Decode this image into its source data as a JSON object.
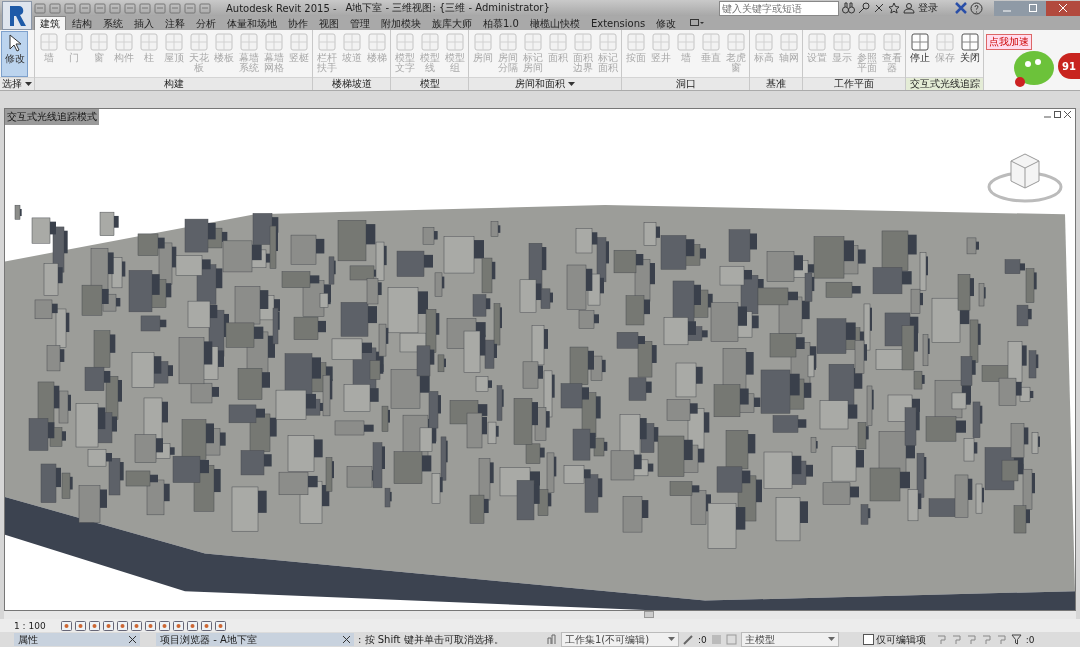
{
  "window": {
    "app_title": "Autodesk Revit 2015 -",
    "document_title": "A地下室 - 三维视图: {三维 - Administrator}"
  },
  "search": {
    "placeholder": "键入关键字或短语"
  },
  "sign_in": "登录",
  "tabs": [
    {
      "label": "建筑",
      "selected": true
    },
    {
      "label": "结构",
      "selected": false
    },
    {
      "label": "系统",
      "selected": false
    },
    {
      "label": "插入",
      "selected": false
    },
    {
      "label": "注释",
      "selected": false
    },
    {
      "label": "分析",
      "selected": false
    },
    {
      "label": "体量和场地",
      "selected": false
    },
    {
      "label": "协作",
      "selected": false
    },
    {
      "label": "视图",
      "selected": false
    },
    {
      "label": "管理",
      "selected": false
    },
    {
      "label": "附加模块",
      "selected": false
    },
    {
      "label": "族库大师",
      "selected": false
    },
    {
      "label": "柏慕1.0",
      "selected": false
    },
    {
      "label": "橄榄山快模",
      "selected": false
    },
    {
      "label": "Extensions",
      "selected": false
    },
    {
      "label": "修改",
      "selected": false
    }
  ],
  "ribbon_panels": [
    {
      "label": "选择",
      "menu": true,
      "highlighted": false,
      "buttons": [
        {
          "label": "修改",
          "selected": true,
          "disabled": false
        }
      ]
    },
    {
      "label": "构建",
      "menu": false,
      "highlighted": false,
      "buttons": [
        {
          "label": "墙",
          "selected": false,
          "disabled": true
        },
        {
          "label": "门",
          "selected": false,
          "disabled": true
        },
        {
          "label": "窗",
          "selected": false,
          "disabled": true
        },
        {
          "label": "构件",
          "selected": false,
          "disabled": true
        },
        {
          "label": "柱",
          "selected": false,
          "disabled": true
        },
        {
          "label": "屋顶",
          "selected": false,
          "disabled": true
        },
        {
          "label": "天花板",
          "selected": false,
          "disabled": true
        },
        {
          "label": "楼板",
          "selected": false,
          "disabled": true
        },
        {
          "label": "幕墙系统",
          "selected": false,
          "disabled": true
        },
        {
          "label": "幕墙网格",
          "selected": false,
          "disabled": true
        },
        {
          "label": "竖梃",
          "selected": false,
          "disabled": true
        }
      ]
    },
    {
      "label": "楼梯坡道",
      "menu": false,
      "highlighted": false,
      "buttons": [
        {
          "label": "栏杆扶手",
          "selected": false,
          "disabled": true
        },
        {
          "label": "坡道",
          "selected": false,
          "disabled": true
        },
        {
          "label": "楼梯",
          "selected": false,
          "disabled": true
        }
      ]
    },
    {
      "label": "模型",
      "menu": false,
      "highlighted": false,
      "buttons": [
        {
          "label": "模型文字",
          "selected": false,
          "disabled": true
        },
        {
          "label": "模型线",
          "selected": false,
          "disabled": true
        },
        {
          "label": "模型组",
          "selected": false,
          "disabled": true
        }
      ]
    },
    {
      "label": "房间和面积",
      "menu": true,
      "highlighted": false,
      "buttons": [
        {
          "label": "房间",
          "selected": false,
          "disabled": true
        },
        {
          "label": "房间分隔",
          "selected": false,
          "disabled": true
        },
        {
          "label": "标记房间",
          "selected": false,
          "disabled": true
        },
        {
          "label": "面积",
          "selected": false,
          "disabled": true
        },
        {
          "label": "面积边界",
          "selected": false,
          "disabled": true
        },
        {
          "label": "标记面积",
          "selected": false,
          "disabled": true
        }
      ]
    },
    {
      "label": "洞口",
      "menu": false,
      "highlighted": false,
      "buttons": [
        {
          "label": "按面",
          "selected": false,
          "disabled": true
        },
        {
          "label": "竖井",
          "selected": false,
          "disabled": true
        },
        {
          "label": "墙",
          "selected": false,
          "disabled": true
        },
        {
          "label": "垂直",
          "selected": false,
          "disabled": true
        },
        {
          "label": "老虎窗",
          "selected": false,
          "disabled": true
        }
      ]
    },
    {
      "label": "基准",
      "menu": false,
      "highlighted": false,
      "buttons": [
        {
          "label": "标高",
          "selected": false,
          "disabled": true
        },
        {
          "label": "轴网",
          "selected": false,
          "disabled": true
        }
      ]
    },
    {
      "label": "工作平面",
      "menu": false,
      "highlighted": false,
      "buttons": [
        {
          "label": "设置",
          "selected": false,
          "disabled": true
        },
        {
          "label": "显示",
          "selected": false,
          "disabled": true
        },
        {
          "label": "参照平面",
          "selected": false,
          "disabled": true
        },
        {
          "label": "查看器",
          "selected": false,
          "disabled": true
        }
      ]
    },
    {
      "label": "交互式光线追踪",
      "menu": false,
      "highlighted": true,
      "buttons": [
        {
          "label": "停止",
          "selected": false,
          "disabled": false
        },
        {
          "label": "保存",
          "selected": false,
          "disabled": true
        },
        {
          "label": "关闭",
          "selected": false,
          "disabled": false
        }
      ]
    }
  ],
  "overlay": {
    "badge": "点我加速",
    "ball": "91"
  },
  "view": {
    "label": "交互式光线追踪模式",
    "scale": "1 : 100"
  },
  "status_bar": {
    "properties_tab": "属性",
    "browser_tab": "项目浏览器 - A地下室",
    "message": ": 按 Shift 键并单击可取消选择。",
    "workset": "工作集1(不可编辑)",
    "editable_count": ":0",
    "design_option": "主模型",
    "editable_only": {
      "label": "仅可编辑项",
      "checked": false
    },
    "filter_count": ":0"
  }
}
